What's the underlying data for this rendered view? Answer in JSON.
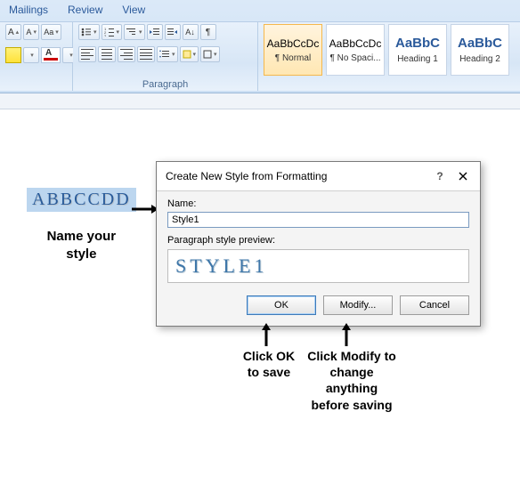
{
  "ribbon": {
    "tabs": [
      "Mailings",
      "Review",
      "View"
    ],
    "font_group": {
      "grow": "A",
      "shrink": "A",
      "clear_format": "Aa",
      "change_case": "Aa",
      "highlight_drop": "▾",
      "font_color_letter": "A"
    },
    "paragraph_group": {
      "label": "Paragraph",
      "bullets_drop": "▾",
      "numbering_drop": "▾",
      "multilevel_drop": "▾",
      "decrease_indent": "",
      "increase_indent": "",
      "sort": "A↓",
      "show_marks": "¶",
      "line_spacing_drop": "▾",
      "shading_drop": "▾",
      "borders_drop": "▾"
    },
    "styles": [
      {
        "preview": "AaBbCcDc",
        "label": "¶ Normal",
        "selected": true,
        "heading": false
      },
      {
        "preview": "AaBbCcDc",
        "label": "¶ No Spaci...",
        "selected": false,
        "heading": false
      },
      {
        "preview": "AaBbC",
        "label": "Heading 1",
        "selected": false,
        "heading": true
      },
      {
        "preview": "AaBbC",
        "label": "Heading 2",
        "selected": false,
        "heading": true
      }
    ]
  },
  "page": {
    "selection_text": "ABBCCDD"
  },
  "dialog": {
    "title": "Create New Style from Formatting",
    "help": "?",
    "name_label": "Name:",
    "name_value": "Style1",
    "preview_label": "Paragraph style preview:",
    "preview_text": "STYLE1",
    "ok": "OK",
    "modify": "Modify...",
    "cancel": "Cancel"
  },
  "annotations": {
    "name_your_style": "Name your\nstyle",
    "click_ok": "Click OK\nto save",
    "click_modify": "Click Modify to\nchange anything\nbefore saving"
  }
}
